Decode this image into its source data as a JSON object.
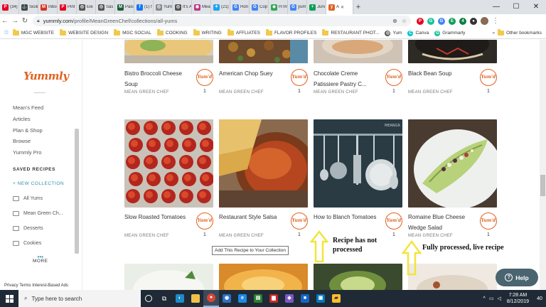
{
  "browser": {
    "tabs": [
      {
        "label": "(34)",
        "color": "#e60023",
        "glyph": "P"
      },
      {
        "label": "Sicili",
        "color": "#444",
        "glyph": "⚓"
      },
      {
        "label": "Inbo",
        "color": "#d93025",
        "glyph": "M"
      },
      {
        "label": "Pint",
        "color": "#e60023",
        "glyph": "P"
      },
      {
        "label": "Ele",
        "color": "#555",
        "glyph": "◎"
      },
      {
        "label": "Sas",
        "color": "#555",
        "glyph": "◎"
      },
      {
        "label": "Pasi",
        "color": "#1e5a3a",
        "glyph": "M"
      },
      {
        "label": "(1) f",
        "color": "#1877f2",
        "glyph": "f"
      },
      {
        "label": "Yum",
        "color": "#888",
        "glyph": "◎"
      },
      {
        "label": "It's A",
        "color": "#555",
        "glyph": "◎"
      },
      {
        "label": "Mea",
        "color": "#c13584",
        "glyph": "◉"
      },
      {
        "label": "(21)",
        "color": "#1da1f2",
        "glyph": "✦"
      },
      {
        "label": "Hon",
        "color": "#4285f4",
        "glyph": "G"
      },
      {
        "label": "Cop",
        "color": "#4285f4",
        "glyph": "G"
      },
      {
        "label": "HTM",
        "color": "#34a853",
        "glyph": "◆"
      },
      {
        "label": "yum",
        "color": "#4285f4",
        "glyph": "G"
      },
      {
        "label": "Juni",
        "color": "#0f9d58",
        "glyph": "+"
      },
      {
        "label": "A",
        "color": "#e16120",
        "glyph": "y",
        "active": true
      }
    ],
    "new_tab": "+",
    "window_controls": {
      "minimize": "—",
      "maximize": "☐",
      "close": "✕"
    },
    "url_host": "yummly.com",
    "url_path": "/profile/MeanGreenChef/collections/all-yums",
    "extensions": [
      {
        "color": "#e60023",
        "glyph": "P"
      },
      {
        "color": "#15c39a",
        "glyph": "G"
      },
      {
        "color": "#4285f4",
        "glyph": "G"
      },
      {
        "color": "#0f9d58",
        "glyph": "E"
      },
      {
        "color": "#0b8043",
        "glyph": "4"
      },
      {
        "color": "#333",
        "glyph": "●"
      }
    ],
    "bookmarks": [
      {
        "label": "MGC WEBSITE",
        "kind": "folder"
      },
      {
        "label": "WEBSITE DESIGN",
        "kind": "folder"
      },
      {
        "label": "MGC SOCIAL",
        "kind": "folder"
      },
      {
        "label": "COOKING",
        "kind": "folder"
      },
      {
        "label": "WRITING",
        "kind": "folder"
      },
      {
        "label": "AFFLIATES",
        "kind": "folder"
      },
      {
        "label": "FLAVOR PROFILES",
        "kind": "folder"
      },
      {
        "label": "RESTAURANT PHOT...",
        "kind": "folder"
      },
      {
        "label": "Yum",
        "kind": "site",
        "color": "#555",
        "glyph": "◎"
      },
      {
        "label": "Canva",
        "kind": "site",
        "color": "#00c4cc",
        "glyph": "C"
      },
      {
        "label": "Grammarly",
        "kind": "site",
        "color": "#15c39a",
        "glyph": "G"
      }
    ],
    "bookmarks_overflow": "»",
    "other_bookmarks": "Other bookmarks"
  },
  "sidebar": {
    "logo": "Yummly",
    "nav": [
      "Mean's Feed",
      "Articles",
      "Plan & Shop",
      "Browse",
      "Yummly Pro"
    ],
    "saved_heading": "SAVED RECIPES",
    "new_collection": "+  NEW COLLECTION",
    "collections": [
      "All Yums",
      "Mean Green Ch...",
      "Desserts",
      "Cookies"
    ],
    "more": "MORE",
    "footer": "Privacy  Terms  Interest-Based Ads"
  },
  "cards_row1": [
    {
      "title": "Bistro Broccoli Cheese Soup",
      "author": "MEAN GREEN CHEF",
      "yums": "1"
    },
    {
      "title": "American Chop Suey",
      "author": "MEAN GREEN CHEF",
      "yums": "1"
    },
    {
      "title": "Chocolate Creme Patissiere Pastry C...",
      "author": "MEAN GREEN CHEF",
      "yums": "1"
    },
    {
      "title": "Black Bean Soup",
      "author": "MEAN GREEN CHEF",
      "yums": "1"
    }
  ],
  "cards_row2": [
    {
      "title": "Slow Roasted Tomatoes",
      "author": "MEAN GREEN CHEF",
      "yums": "1"
    },
    {
      "title": "Restaurant Style Salsa",
      "author": "MEAN GREEN CHEF",
      "yums": "1"
    },
    {
      "title": "How to Blanch Tomatoes",
      "author": "",
      "yums": "1"
    },
    {
      "title": "Romaine Blue Cheese Wedge Salad",
      "author": "MEAN GREEN CHEF",
      "yums": "1"
    }
  ],
  "yum_badge_text": "Yum'd",
  "tooltip": "Add This Recipe to Your Collection",
  "annotations": {
    "not_processed": "Recipe has not processed",
    "processed": "Fully processed, live recipe"
  },
  "help_label": "Help",
  "taskbar": {
    "search_placeholder": "Type here to search",
    "time": "7:28 AM",
    "date": "8/12/2019",
    "notifications": "40"
  }
}
